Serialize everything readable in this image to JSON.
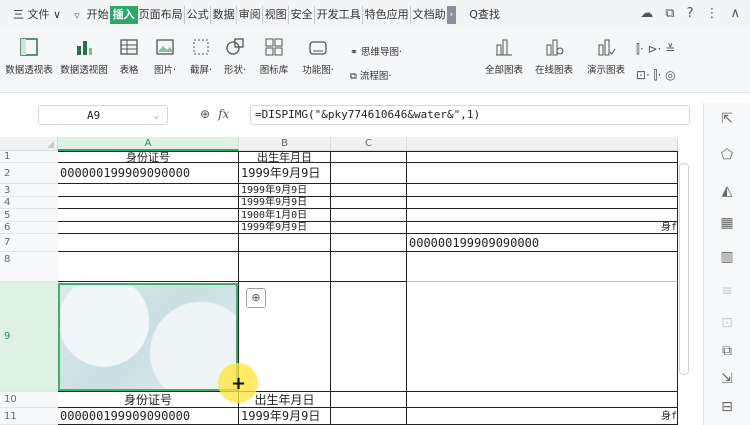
{
  "menu": {
    "file_label": "三 文件",
    "file_arrow": "∨",
    "tabs": [
      "开始",
      "插入",
      "页面布局",
      "公式",
      "数据",
      "审阅",
      "视图",
      "安全",
      "开发工具",
      "特色应用",
      "文档助"
    ],
    "active_tab": "插入",
    "more_label": "›",
    "search_label": "Q查找"
  },
  "ribbon": {
    "buttons": [
      "数据透视表",
      "数据透视图",
      "表格",
      "图片·",
      "截屏·",
      "形状·",
      "图标库",
      "功能图·",
      "全部图表",
      "在线图表",
      "演示图表"
    ],
    "small_1": "思维导图·",
    "small_2": "流程图·"
  },
  "formula_bar": {
    "name_box": "A9",
    "formula": "=DISPIMG(\"&pky774610646&water&\",1)"
  },
  "grid": {
    "columns": [
      "A",
      "B",
      "C"
    ],
    "rows": [
      "1",
      "2",
      "3",
      "4",
      "5",
      "6",
      "7",
      "8",
      "9",
      "10",
      "11"
    ],
    "selected_column": "A",
    "selected_row": "9",
    "cells": {
      "A1": "身份证号",
      "B1": "出生年月日",
      "A2": "000000199909090000",
      "B2": "1999年9月9日",
      "B3": "1999年9月9日",
      "B4": "1999年9月9日",
      "B5": "1900年1月0日",
      "B6": "1999年9月9日",
      "D6": "身f",
      "D7": "000000199909090000",
      "A10": "身份证号",
      "B10": "出生年月日",
      "A11": "000000199909090000",
      "B11": "1999年9月9日",
      "D11": "身f"
    }
  },
  "colors": {
    "accent": "#2ea86a"
  },
  "icons": [
    "zoom-icon",
    "crosshair-cursor-icon"
  ]
}
